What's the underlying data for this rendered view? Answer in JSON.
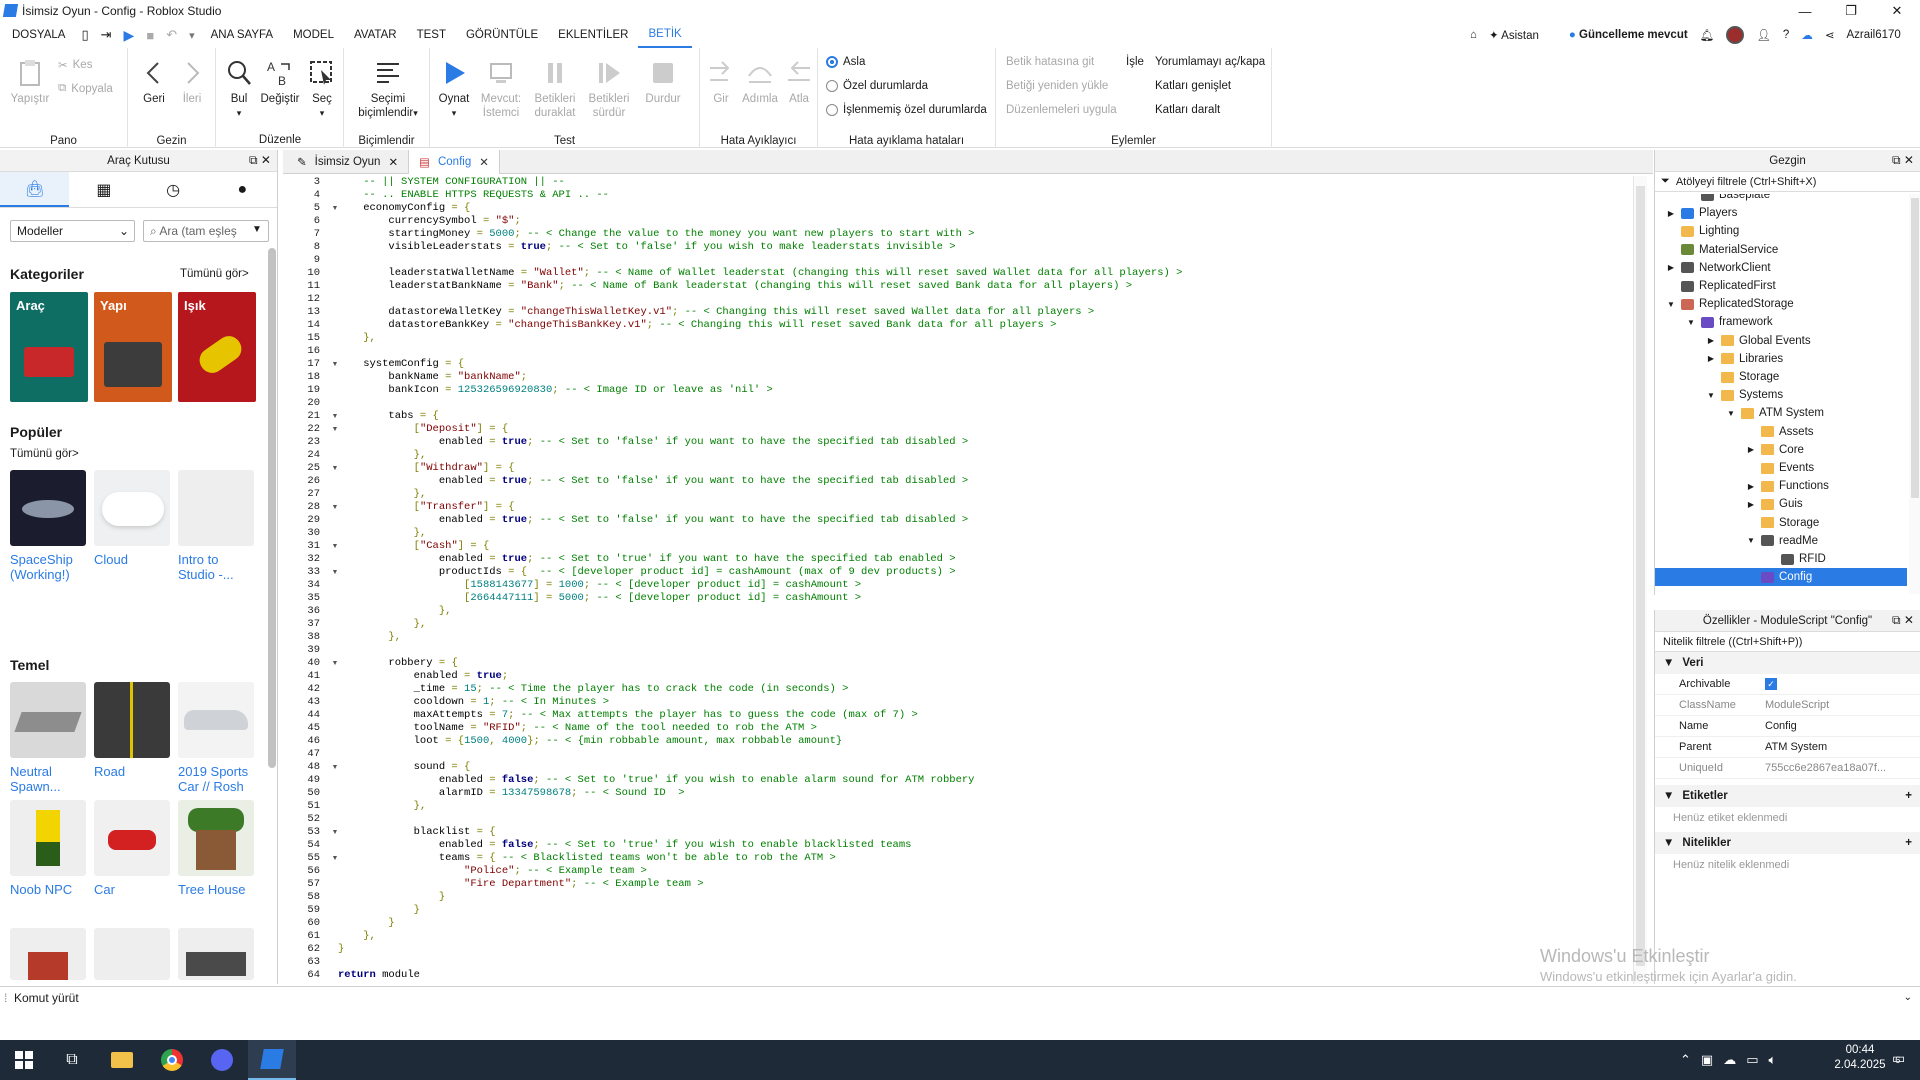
{
  "window": {
    "title": "İsimsiz Oyun - Config - Roblox Studio"
  },
  "menu": {
    "file": "DOSYALA",
    "tabs": [
      "ANA SAYFA",
      "MODEL",
      "AVATAR",
      "TEST",
      "GÖRÜNTÜLE",
      "EKLENTİLER",
      "BETİK"
    ],
    "right": {
      "assistant": "Asistan",
      "update": "Güncelleme mevcut",
      "user": "Azrail6170"
    }
  },
  "ribbon": {
    "pano": {
      "label": "Pano",
      "paste": "Yapıştır",
      "cut": "Kes",
      "copy": "Kopyala"
    },
    "gezin": {
      "label": "Gezin",
      "back": "Geri",
      "forward": "İleri"
    },
    "duzenle": {
      "label": "Düzenle",
      "find": "Bul",
      "replace": "Değiştir",
      "select": "Seç"
    },
    "bicim": {
      "label": "Biçimlendir",
      "format1": "Seçimi",
      "format2": "biçimlendir"
    },
    "test": {
      "label": "Test",
      "play": "Oynat",
      "current1": "Mevcut:",
      "current2": "İstemci",
      "pause1": "Betikleri",
      "pause2": "duraklat",
      "resume1": "Betikleri",
      "resume2": "sürdür",
      "stop": "Durdur"
    },
    "hata": {
      "label": "Hata Ayıklayıcı",
      "stepin": "Gir",
      "stepover": "Adımla",
      "stepout": "Atla"
    },
    "hatalar": {
      "label": "Hata ayıklama hataları",
      "opt1": "Asla",
      "opt2": "Özel durumlarda",
      "opt3": "İşlenmemiş özel durumlarda"
    },
    "eylem": {
      "label": "Eylemler",
      "a1": "Betik hatasına git",
      "a2": "İşle",
      "a3": "Betiği yeniden yükle",
      "a4": "Düzenlemeleri uygula",
      "a5": "Yorumlamayı aç/kapa",
      "a6": "Katları genişlet",
      "a7": "Katları daralt"
    }
  },
  "toolbox": {
    "title": "Araç Kutusu",
    "dropdown": "Modeller",
    "search_placeholder": "Ara (tam eşleş",
    "categories_title": "Kategoriler",
    "see_all": "Tümünü gör>",
    "cat": [
      "Araç",
      "Yapı",
      "Işık"
    ],
    "popular_title": "Popüler",
    "popular_see_all": "Tümünü gör>",
    "popular": [
      {
        "l1": "SpaceShip",
        "l2": "(Working!)"
      },
      {
        "l1": "Cloud",
        "l2": ""
      },
      {
        "l1": "Intro to",
        "l2": "Studio -..."
      }
    ],
    "basic_title": "Temel",
    "basic": [
      {
        "l1": "Neutral",
        "l2": "Spawn..."
      },
      {
        "l1": "Road",
        "l2": ""
      },
      {
        "l1": "2019 Sports",
        "l2": "Car // Rosh"
      },
      {
        "l1": "Noob NPC",
        "l2": ""
      },
      {
        "l1": "Car",
        "l2": ""
      },
      {
        "l1": "Tree House",
        "l2": ""
      }
    ]
  },
  "editor": {
    "tabs": [
      "İsimsiz Oyun",
      "Config"
    ],
    "first_line": 3
  },
  "explorer": {
    "title": "Gezgin",
    "filter": "Atölyeyi filtrele (Ctrl+Shift+X)",
    "items": [
      {
        "t": "Baseplate",
        "d": 1,
        "a": ""
      },
      {
        "t": "Players",
        "d": 0,
        "a": "r"
      },
      {
        "t": "Lighting",
        "d": 0,
        "a": ""
      },
      {
        "t": "MaterialService",
        "d": 0,
        "a": ""
      },
      {
        "t": "NetworkClient",
        "d": 0,
        "a": "r"
      },
      {
        "t": "ReplicatedFirst",
        "d": 0,
        "a": ""
      },
      {
        "t": "ReplicatedStorage",
        "d": 0,
        "a": "d"
      },
      {
        "t": "framework",
        "d": 1,
        "a": "d"
      },
      {
        "t": "Global Events",
        "d": 2,
        "a": "r"
      },
      {
        "t": "Libraries",
        "d": 2,
        "a": "r"
      },
      {
        "t": "Storage",
        "d": 2,
        "a": ""
      },
      {
        "t": "Systems",
        "d": 2,
        "a": "d"
      },
      {
        "t": "ATM System",
        "d": 3,
        "a": "d"
      },
      {
        "t": "Assets",
        "d": 4,
        "a": ""
      },
      {
        "t": "Core",
        "d": 4,
        "a": "r"
      },
      {
        "t": "Events",
        "d": 4,
        "a": ""
      },
      {
        "t": "Functions",
        "d": 4,
        "a": "r"
      },
      {
        "t": "Guis",
        "d": 4,
        "a": "r"
      },
      {
        "t": "Storage",
        "d": 4,
        "a": ""
      },
      {
        "t": "readMe",
        "d": 4,
        "a": "d"
      },
      {
        "t": "RFID",
        "d": 5,
        "a": ""
      },
      {
        "t": "Config",
        "d": 4,
        "a": ""
      }
    ]
  },
  "properties": {
    "title": "Özellikler - ModuleScript \"Config\"",
    "filter": "Nitelik filtrele ((Ctrl+Shift+P))",
    "data_section": "Veri",
    "rows": [
      {
        "k": "Archivable",
        "v": ""
      },
      {
        "k": "ClassName",
        "v": "ModuleScript"
      },
      {
        "k": "Name",
        "v": "Config"
      },
      {
        "k": "Parent",
        "v": "ATM System"
      },
      {
        "k": "UniqueId",
        "v": "755cc6e2867ea18a07f..."
      }
    ],
    "tags_section": "Etiketler",
    "tags_empty": "Henüz etiket eklenmedi",
    "attr_section": "Nitelikler",
    "attr_empty": "Henüz nitelik eklenmedi"
  },
  "watermark": {
    "l1": "Windows'u Etkinleştir",
    "l2": "Windows'u etkinleştirmek için Ayarlar'a gidin."
  },
  "command": {
    "placeholder": "Komut yürüt"
  },
  "taskbar": {
    "time": "00:44",
    "date": "2.04.2025",
    "notif": "6"
  }
}
